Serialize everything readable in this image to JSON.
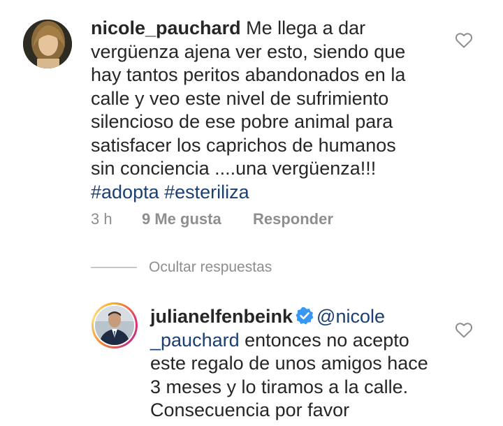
{
  "comment1": {
    "username": "nicole_pauchard",
    "text": " Me llega a dar vergüenza ajena ver esto, siendo que hay tantos peritos abandonados en la calle y veo este nivel de sufrimiento silencioso de ese pobre animal para satisfacer los caprichos de humanos sin conciencia ....una vergüenza!!! ",
    "hashtags": [
      "#adopta",
      "#esteriliza"
    ],
    "time": "3 h",
    "likes": "9 Me gusta",
    "reply_label": "Responder"
  },
  "replies_toggle": {
    "label": "Ocultar respuestas"
  },
  "comment2": {
    "username": "julianelfenbeink",
    "verified": true,
    "mention": "@nicole_pauchard",
    "mention_part1": "@nicole",
    "mention_part2": "_pauchard",
    "text": " entonces no acepto este regalo de unos amigos hace 3 meses y lo tiramos a la calle. Consecuencia por favor"
  },
  "colors": {
    "hashtag": "#1b3f73",
    "meta": "#8e8e8e",
    "verified": "#3897f0"
  },
  "icons": {
    "like": "heart-outline-icon",
    "verified": "verified-badge-icon"
  }
}
